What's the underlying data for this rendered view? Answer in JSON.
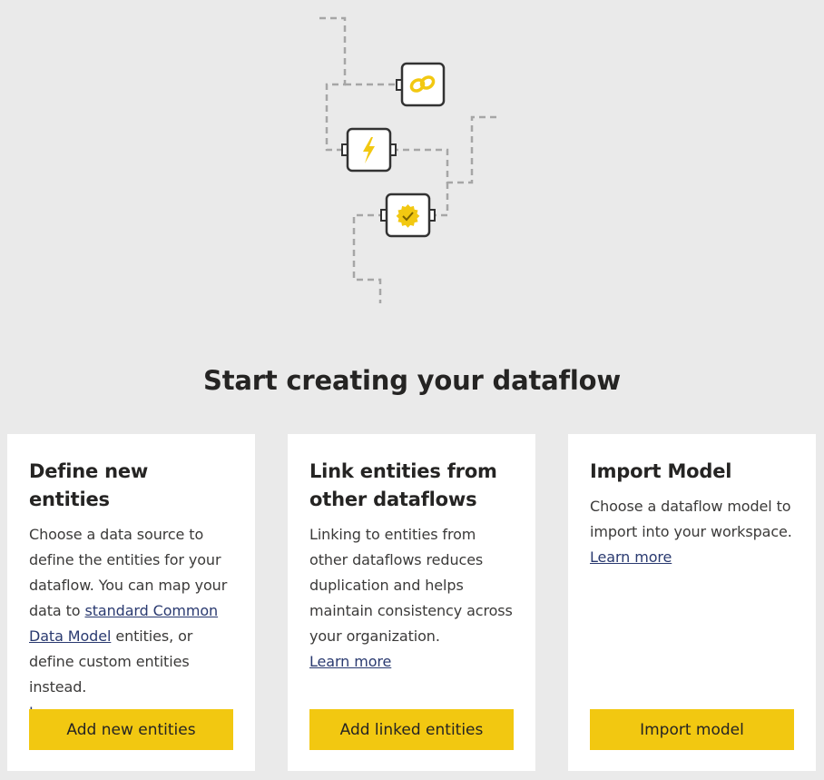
{
  "page": {
    "title": "Start creating your dataflow"
  },
  "illustration": {
    "accent_color": "#f2c811",
    "icons": [
      "link-icon",
      "lightning-icon",
      "badge-check-icon"
    ]
  },
  "cards": [
    {
      "title": "Define new entities",
      "desc_before": "Choose a data source to define the entities for your dataflow. You can map your data to ",
      "desc_link": "standard Common Data Model",
      "desc_after": " entities, or define custom entities instead.",
      "learn_more": "Learn more",
      "button": "Add new entities"
    },
    {
      "title": "Link entities from other dataflows",
      "desc": "Linking to entities from other dataflows reduces duplication and helps maintain consistency across your organization.",
      "learn_more": "Learn more",
      "button": "Add linked entities"
    },
    {
      "title": "Import Model",
      "desc": "Choose a dataflow model to import into your workspace.",
      "learn_more": "Learn more",
      "button": "Import model"
    }
  ]
}
